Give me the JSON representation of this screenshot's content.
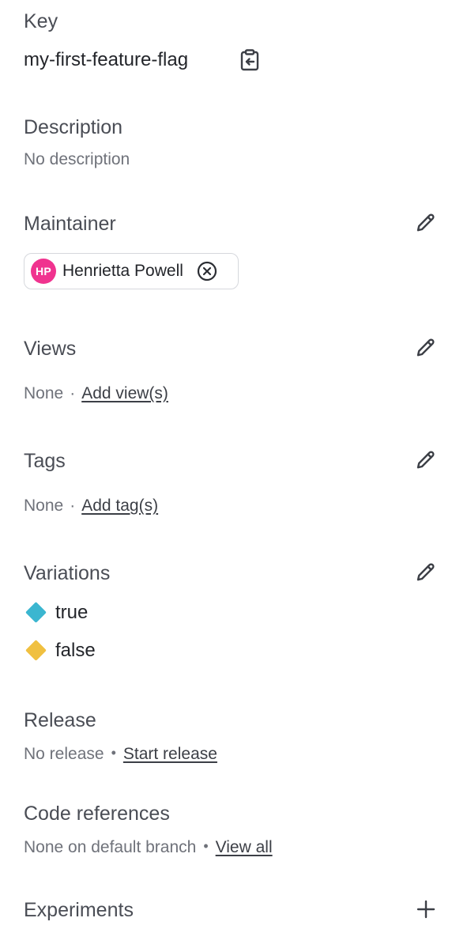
{
  "key": {
    "heading": "Key",
    "value": "my-first-feature-flag",
    "copy_icon": "clipboard-copy-icon"
  },
  "description": {
    "heading": "Description",
    "value": "No description"
  },
  "maintainer": {
    "heading": "Maintainer",
    "edit_icon": "pencil-icon",
    "initials": "HP",
    "name": "Henrietta Powell",
    "avatar_color": "#f0338f",
    "remove_icon": "circle-x-icon"
  },
  "views": {
    "heading": "Views",
    "value": "None",
    "separator": "·",
    "action": "Add view(s)"
  },
  "tags": {
    "heading": "Tags",
    "value": "None",
    "separator": "·",
    "action": "Add tag(s)"
  },
  "variations": {
    "heading": "Variations",
    "items": [
      {
        "label": "true",
        "color": "#3bb6d0",
        "icon": "diamond-icon"
      },
      {
        "label": "false",
        "color": "#f0c040",
        "icon": "diamond-icon"
      }
    ]
  },
  "release": {
    "heading": "Release",
    "value": "No release",
    "separator": "•",
    "action": "Start release"
  },
  "code_references": {
    "heading": "Code references",
    "value": "None on default branch",
    "separator": "•",
    "action": "View all"
  },
  "experiments": {
    "heading": "Experiments",
    "add_icon": "plus-icon"
  }
}
